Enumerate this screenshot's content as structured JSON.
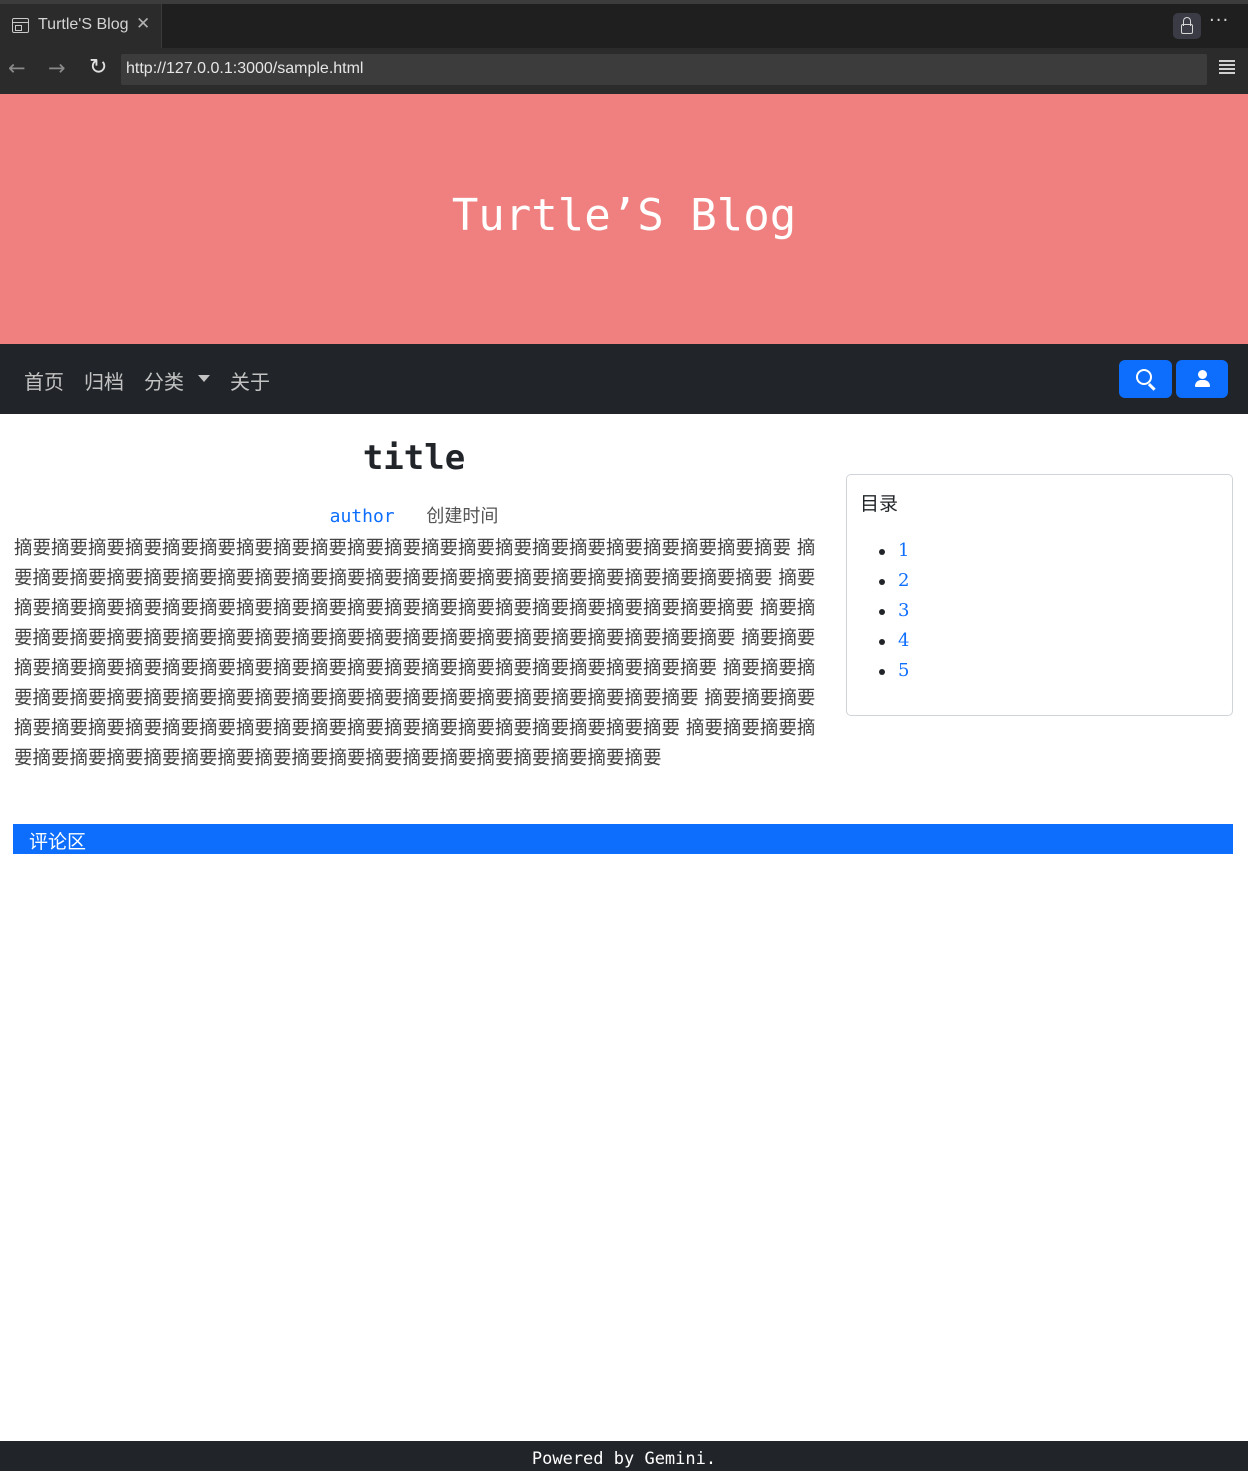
{
  "browser": {
    "tab_title": "Turtle'S Blog",
    "tab_close": "✕",
    "url": "http://127.0.0.1:3000/sample.html",
    "back_glyph": "←",
    "forward_glyph": "→",
    "reload_glyph": "↻",
    "more_glyph": "···"
  },
  "header": {
    "site_title": "Turtle’S Blog",
    "bg_color": "#f08080"
  },
  "navbar": {
    "items": [
      {
        "label": "首页"
      },
      {
        "label": "归档"
      },
      {
        "label": "分类"
      },
      {
        "label": "关于"
      }
    ],
    "search_icon": "search-icon",
    "user_icon": "user-icon",
    "button_color": "#0d6efd"
  },
  "post": {
    "title": "title",
    "author": "author",
    "created_label": "创建时间",
    "body": "摘要摘要摘要摘要摘要摘要摘要摘要摘要摘要摘要摘要摘要摘要摘要摘要摘要摘要摘要摘要摘要 摘要摘要摘要摘要摘要摘要摘要摘要摘要摘要摘要摘要摘要摘要摘要摘要摘要摘要摘要摘要摘要 摘要摘要摘要摘要摘要摘要摘要摘要摘要摘要摘要摘要摘要摘要摘要摘要摘要摘要摘要摘要摘要 摘要摘要摘要摘要摘要摘要摘要摘要摘要摘要摘要摘要摘要摘要摘要摘要摘要摘要摘要摘要摘要 摘要摘要摘要摘要摘要摘要摘要摘要摘要摘要摘要摘要摘要摘要摘要摘要摘要摘要摘要摘要摘要 摘要摘要摘要摘要摘要摘要摘要摘要摘要摘要摘要摘要摘要摘要摘要摘要摘要摘要摘要摘要摘要 摘要摘要摘要摘要摘要摘要摘要摘要摘要摘要摘要摘要摘要摘要摘要摘要摘要摘要摘要摘要摘要 摘要摘要摘要摘要摘要摘要摘要摘要摘要摘要摘要摘要摘要摘要摘要摘要摘要摘要摘要摘要摘要"
  },
  "toc": {
    "title": "目录",
    "items": [
      "1",
      "2",
      "3",
      "4",
      "5"
    ]
  },
  "comments": {
    "label": "评论区"
  },
  "footer": {
    "text": "Powered by Gemini."
  }
}
